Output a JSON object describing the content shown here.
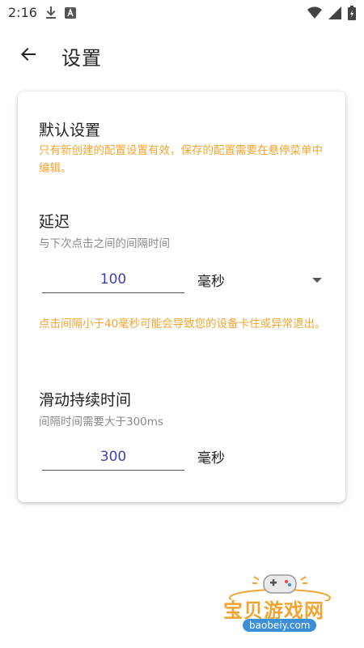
{
  "status_bar": {
    "time": "2:16"
  },
  "app_bar": {
    "title": "设置"
  },
  "card": {
    "default_section": {
      "title": "默认设置",
      "note": "只有新创建的配置设置有效，保存的配置需要在悬停菜单中编辑。"
    },
    "delay_section": {
      "title": "延迟",
      "subtitle": "与下次点击之间的间隔时间",
      "value": "100",
      "unit": "毫秒",
      "warning": "点击间隔小于40毫秒可能会导致您的设备卡住或异常退出。"
    },
    "swipe_section": {
      "title": "滑动持续时间",
      "subtitle": "间隔时间需要大于300ms",
      "value": "300",
      "unit": "毫秒"
    }
  },
  "watermark": {
    "text": "宝贝游戏网",
    "url": "baobeiy.com"
  },
  "colors": {
    "accent_warning": "#f0a532",
    "input_value": "#3f3fb5"
  }
}
